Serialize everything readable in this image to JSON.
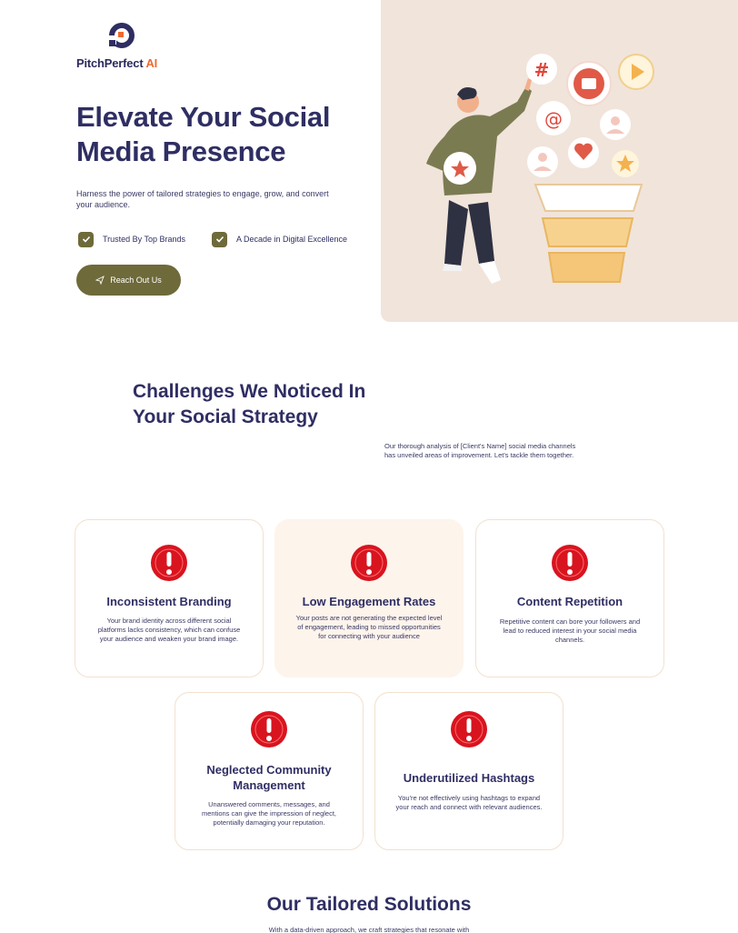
{
  "brand": {
    "name": "PitchPerfect",
    "suffix": "AI",
    "accent": "#ef6a2f",
    "primary": "#2f2e63",
    "olive": "#6e6a3a"
  },
  "hero": {
    "title": "Elevate Your Social Media Presence",
    "subtitle": "Harness the power of tailored strategies to engage, grow, and convert your audience.",
    "badges": [
      "Trusted By Top Brands",
      "A Decade in Digital Excellence"
    ],
    "cta_label": "Reach Out Us",
    "cta_icon": "paper-plane-icon",
    "panel_color": "#f1e4da"
  },
  "challenges": {
    "title": "Challenges We Noticed In Your Social Strategy",
    "description": "Our thorough analysis of [Client's Name] social media channels has unveiled areas of improvement. Let's tackle them together.",
    "cards": [
      {
        "title": "Inconsistent Branding",
        "text": "Your brand identity across different social platforms lacks consistency, which can confuse your audience and weaken your brand image.",
        "icon": "alert-icon"
      },
      {
        "title": "Low Engagement Rates",
        "text": "Your posts are not generating the expected level of engagement, leading to missed opportunities for connecting with your audience",
        "icon": "alert-icon"
      },
      {
        "title": "Content Repetition",
        "text": "Repetitive content can bore your followers and lead to reduced interest in your social media channels.",
        "icon": "alert-icon"
      },
      {
        "title": "Neglected Community Management",
        "text": "Unanswered comments, messages, and mentions can give the impression of neglect, potentially damaging your reputation.",
        "icon": "alert-icon"
      },
      {
        "title": "Underutilized Hashtags",
        "text": "You're not effectively using hashtags to expand your reach and connect with relevant audiences.",
        "icon": "alert-icon"
      }
    ]
  },
  "solutions": {
    "title": "Our Tailored Solutions",
    "description": "With a data-driven approach, we craft strategies that resonate with"
  }
}
